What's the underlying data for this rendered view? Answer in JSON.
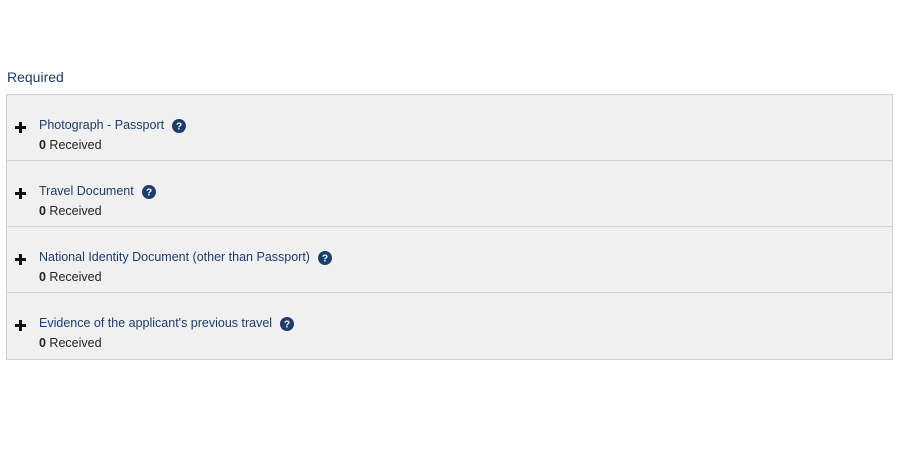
{
  "section": {
    "title": "Required"
  },
  "colors": {
    "title_text": "#1d3d6b",
    "help_icon_bg": "#1d3d6b",
    "row_bg": "#f0f0f0",
    "border": "#cfcfcf"
  },
  "documents": [
    {
      "title": "Photograph - Passport",
      "count": "0",
      "count_label": " Received",
      "expand_icon": "plus-icon",
      "help_icon": "help-icon"
    },
    {
      "title": "Travel Document",
      "count": "0",
      "count_label": " Received",
      "expand_icon": "plus-icon",
      "help_icon": "help-icon"
    },
    {
      "title": "National Identity Document (other than Passport)",
      "count": "0",
      "count_label": " Received",
      "expand_icon": "plus-icon",
      "help_icon": "help-icon"
    },
    {
      "title": "Evidence of the applicant's previous travel",
      "count": "0",
      "count_label": " Received",
      "expand_icon": "plus-icon",
      "help_icon": "help-icon"
    }
  ]
}
